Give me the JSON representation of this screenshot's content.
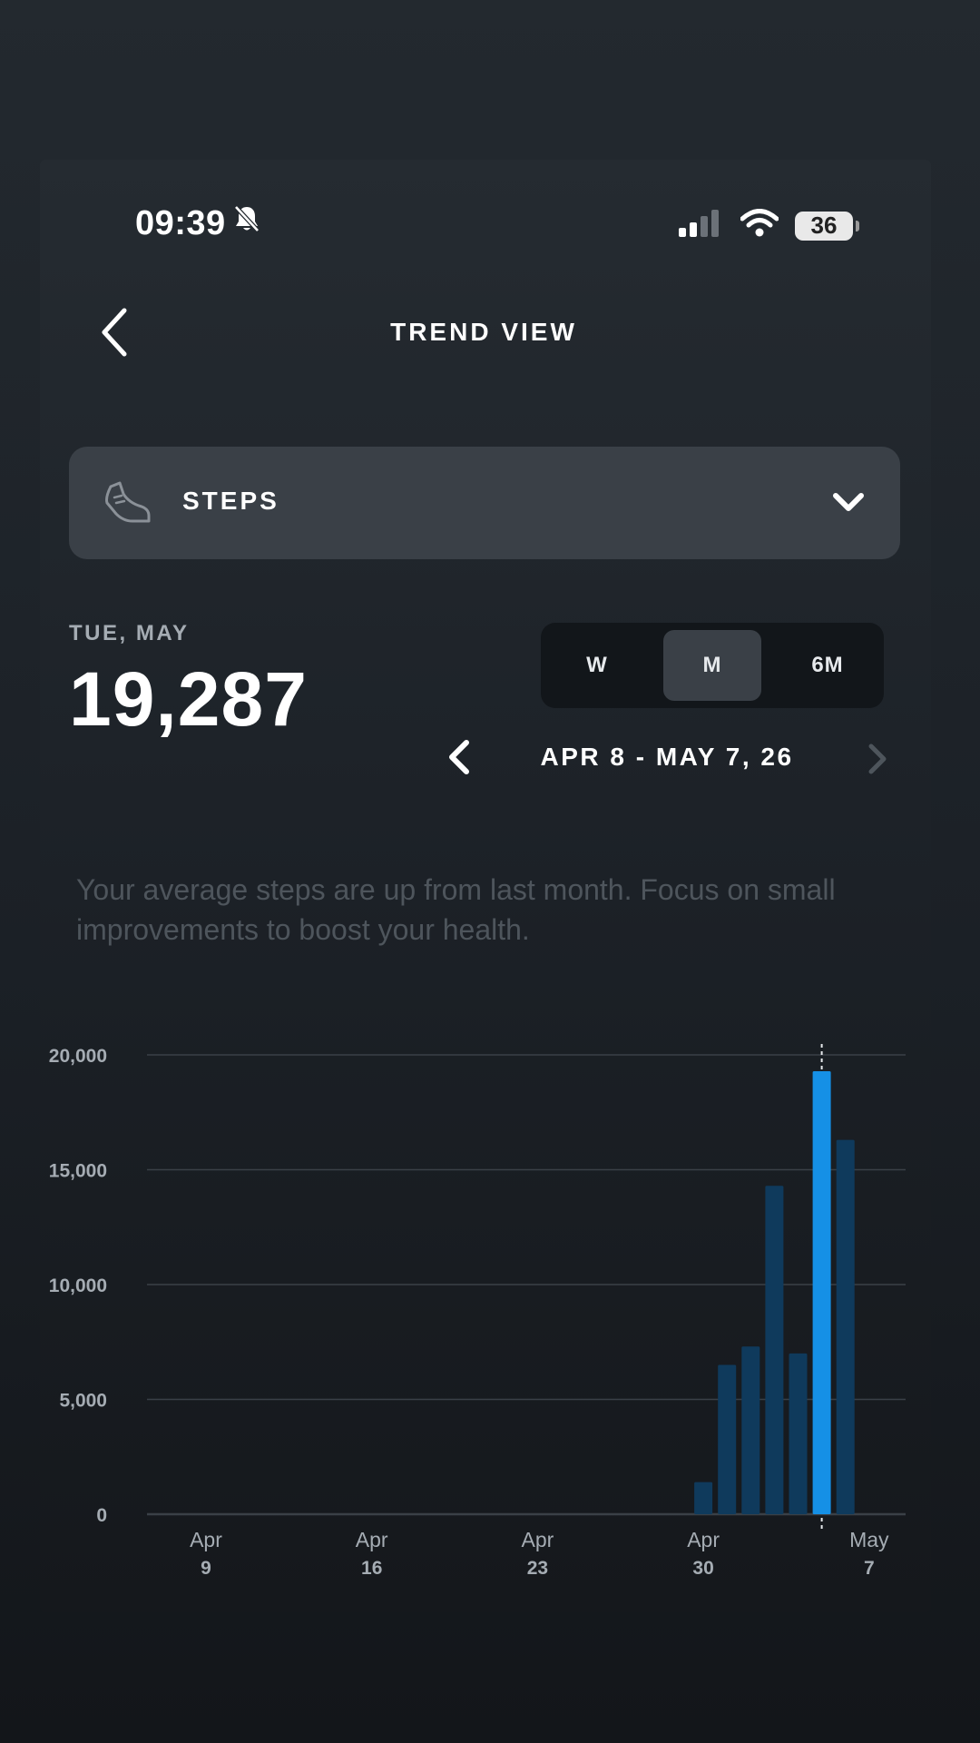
{
  "status_bar": {
    "time": "09:39",
    "battery": "36",
    "icons": [
      "bell-slash-icon",
      "cellular-signal-icon",
      "wifi-icon",
      "battery-icon"
    ]
  },
  "header": {
    "title": "TREND VIEW",
    "back_icon": "chevron-left-icon"
  },
  "metric_selector": {
    "icon": "shoe-icon",
    "label": "STEPS",
    "chevron_icon": "chevron-down-icon"
  },
  "summary": {
    "date_label": "TUE, MAY",
    "value": "19,287"
  },
  "period_toggle": {
    "options": [
      "W",
      "M",
      "6M"
    ],
    "selected": "M"
  },
  "range": {
    "label": "APR 8 - MAY 7, 26",
    "prev_icon": "chevron-left-icon",
    "next_icon": "chevron-right-icon"
  },
  "insight": "Your average steps are up from last month. Focus on small improvements to boost your health.",
  "colors": {
    "bar": "#0f3a5c",
    "bar_selected": "#1590e6",
    "grid": "#3a4047",
    "axis_text": "#a5acb3"
  },
  "chart_data": {
    "type": "bar",
    "title": "",
    "xlabel": "",
    "ylabel": "",
    "ylim": [
      0,
      20000
    ],
    "y_ticks": [
      "0",
      "5,000",
      "10,000",
      "15,000",
      "20,000"
    ],
    "y_tick_values": [
      0,
      5000,
      10000,
      15000,
      20000
    ],
    "x_tick_labels": [
      {
        "top": "Apr",
        "bottom": "9"
      },
      {
        "top": "Apr",
        "bottom": "16"
      },
      {
        "top": "Apr",
        "bottom": "23"
      },
      {
        "top": "Apr",
        "bottom": "30"
      },
      {
        "top": "May",
        "bottom": "7"
      }
    ],
    "x_tick_dates": [
      "Apr 9",
      "Apr 16",
      "Apr 23",
      "Apr 30",
      "May 7"
    ],
    "categories": [
      "Apr 8",
      "Apr 9",
      "Apr 10",
      "Apr 11",
      "Apr 12",
      "Apr 13",
      "Apr 14",
      "Apr 15",
      "Apr 16",
      "Apr 17",
      "Apr 18",
      "Apr 19",
      "Apr 20",
      "Apr 21",
      "Apr 22",
      "Apr 23",
      "Apr 24",
      "Apr 25",
      "Apr 26",
      "Apr 27",
      "Apr 28",
      "Apr 29",
      "Apr 30",
      "May 1",
      "May 2",
      "May 3",
      "May 4",
      "May 5",
      "May 6",
      "May 7"
    ],
    "values": [
      0,
      0,
      0,
      0,
      0,
      0,
      0,
      0,
      0,
      0,
      0,
      0,
      0,
      0,
      0,
      0,
      0,
      0,
      0,
      0,
      0,
      0,
      1400,
      6500,
      7300,
      14300,
      7000,
      19287,
      16300,
      0
    ],
    "selected": "May 5",
    "grid": true
  }
}
